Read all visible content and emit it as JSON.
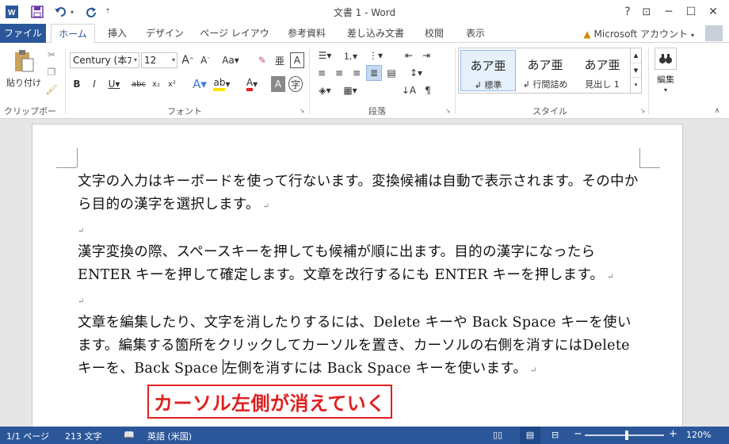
{
  "titlebar": {
    "title": "文書 1 - Word",
    "help": "?",
    "ribbon_display": "⊡",
    "minimize": "─",
    "maximize": "☐",
    "close": "✕"
  },
  "tabs": [
    {
      "label": "ファイル"
    },
    {
      "label": "ホーム"
    },
    {
      "label": "挿入"
    },
    {
      "label": "デザイン"
    },
    {
      "label": "ページ レイアウト"
    },
    {
      "label": "参考資料"
    },
    {
      "label": "差し込み文書"
    },
    {
      "label": "校閲"
    },
    {
      "label": "表示"
    }
  ],
  "account": {
    "label": "Microsoft アカウント"
  },
  "ribbon": {
    "clipboard": {
      "paste_label": "貼り付け",
      "group_label": "クリップボード"
    },
    "font": {
      "name": "Century (本ﾌ",
      "size": "12",
      "group_label": "フォント"
    },
    "paragraph": {
      "group_label": "段落"
    },
    "styles": {
      "group_label": "スタイル",
      "items": [
        {
          "sample": "あア亜",
          "name": "↲ 標準"
        },
        {
          "sample": "あア亜",
          "name": "↲ 行間詰め"
        },
        {
          "sample": "あア亜",
          "name": "見出し 1"
        }
      ]
    },
    "editing": {
      "label": "編集"
    }
  },
  "document": {
    "para1": "文字の入力はキーボードを使って行ないます。変換候補は自動で表示されます。その中から目的の漢字を選択します。",
    "para2": "漢字変換の際、スペースキーを押しても候補が順に出ます。目的の漢字になったらENTER キーを押して確定します。文章を改行するにも ENTER キーを押します。",
    "para3_before": "文章を編集したり、文字を消したりするには、Delete キーや Back Space キーを使います。編集する箇所をクリックしてカーソルを置き、カーソルの右側を消すにはDelete キーを、Back Space ",
    "para3_after": "左側を消すには Back Space キーを使います。",
    "para_mark": "↵",
    "callout": "カーソル左側が消えていく"
  },
  "status": {
    "page": "1/1 ページ",
    "words": "213 文字",
    "language": "英語 (米国)",
    "zoom": "120%",
    "zoom_minus": "−",
    "zoom_plus": "+"
  },
  "colors": {
    "brand": "#2b579a",
    "callout": "#e02020"
  }
}
